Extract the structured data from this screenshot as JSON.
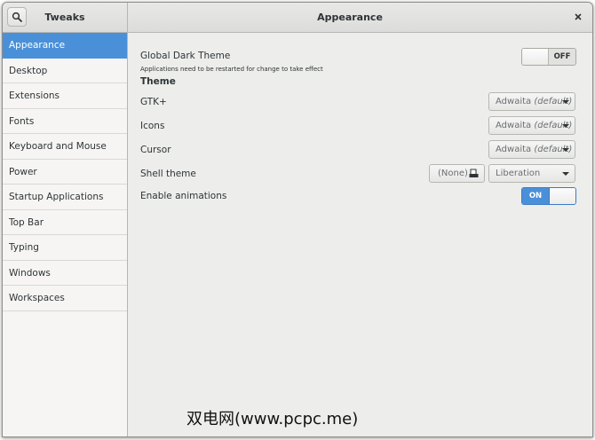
{
  "header": {
    "app_title": "Tweaks",
    "page_title": "Appearance"
  },
  "sidebar": {
    "items": [
      {
        "label": "Appearance",
        "active": true
      },
      {
        "label": "Desktop"
      },
      {
        "label": "Extensions"
      },
      {
        "label": "Fonts"
      },
      {
        "label": "Keyboard and Mouse"
      },
      {
        "label": "Power"
      },
      {
        "label": "Startup Applications"
      },
      {
        "label": "Top Bar"
      },
      {
        "label": "Typing"
      },
      {
        "label": "Windows"
      },
      {
        "label": "Workspaces"
      }
    ]
  },
  "appearance": {
    "global_dark_theme": {
      "label": "Global Dark Theme",
      "note": "Applications need to be restarted for change to take effect",
      "state": "OFF"
    },
    "theme_title": "Theme",
    "gtk": {
      "label": "GTK+",
      "value": "Adwaita",
      "suffix": "(default)"
    },
    "icons": {
      "label": "Icons",
      "value": "Adwaita",
      "suffix": "(default)"
    },
    "cursor": {
      "label": "Cursor",
      "value": "Adwaita",
      "suffix": "(default)"
    },
    "shell_theme": {
      "label": "Shell theme",
      "file_button": "(None)",
      "value": "Liberation"
    },
    "animations": {
      "label": "Enable animations",
      "state": "ON"
    }
  },
  "watermark": "双电网(www.pcpc.me)",
  "colors": {
    "accent": "#4a90d9",
    "window_bg": "#ededec",
    "sidebar_bg": "#f6f5f4"
  },
  "icons": {
    "search": "search-icon",
    "close": "close-icon",
    "file": "document-open-icon"
  }
}
